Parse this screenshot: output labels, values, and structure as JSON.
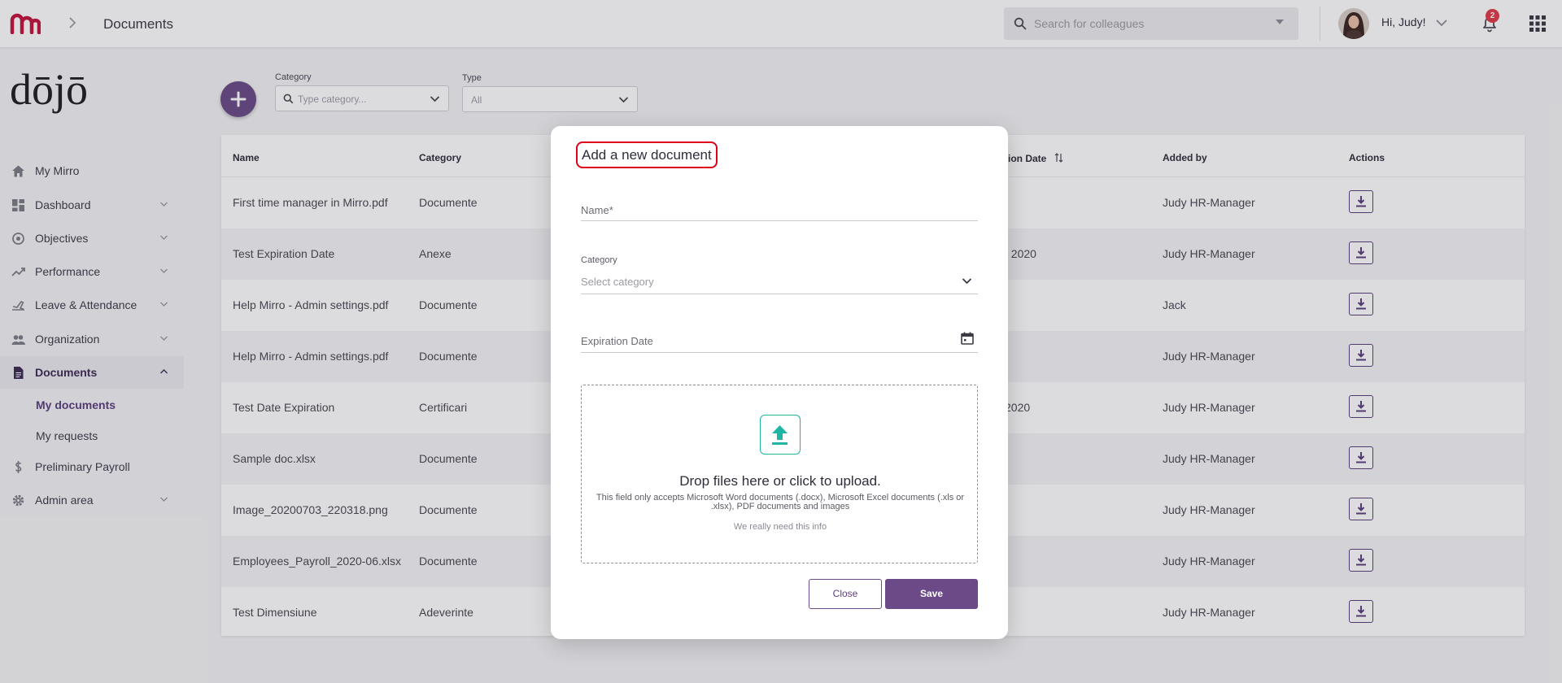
{
  "header": {
    "breadcrumb": "Documents",
    "search_placeholder": "Search for colleagues",
    "greeting": "Hi, Judy!",
    "notification_count": "2"
  },
  "brand": {
    "logo_text": "dōjō"
  },
  "sidebar": {
    "items": [
      {
        "label": "My Mirro",
        "icon": "home-icon"
      },
      {
        "label": "Dashboard",
        "icon": "dashboard-icon"
      },
      {
        "label": "Objectives",
        "icon": "target-icon"
      },
      {
        "label": "Performance",
        "icon": "trend-icon"
      },
      {
        "label": "Leave & Attendance",
        "icon": "plane-icon"
      },
      {
        "label": "Organization",
        "icon": "people-icon"
      },
      {
        "label": "Documents",
        "icon": "document-icon"
      },
      {
        "label": "Preliminary Payroll",
        "icon": "dollar-icon"
      },
      {
        "label": "Admin area",
        "icon": "gear-icon"
      }
    ],
    "sub_items": [
      "My documents",
      "My requests"
    ]
  },
  "filters": {
    "category_label": "Category",
    "category_placeholder": "Type category...",
    "type_label": "Type",
    "type_value": "All"
  },
  "table": {
    "headers": {
      "name": "Name",
      "category": "Category",
      "expiration": "tion Date",
      "added_by": "Added by",
      "actions": "Actions"
    },
    "rows": [
      {
        "name": "First time manager in Mirro.pdf",
        "category": "Documente",
        "exp": "",
        "added_by": "Judy HR-Manager"
      },
      {
        "name": "Test Expiration Date",
        "category": "Anexe",
        "exp": ", 2020",
        "added_by": "Judy HR-Manager"
      },
      {
        "name": "Help Mirro - Admin settings.pdf",
        "category": "Documente",
        "exp": "",
        "added_by": "Jack"
      },
      {
        "name": "Help Mirro - Admin settings.pdf",
        "category": "Documente",
        "exp": "",
        "added_by": "Judy HR-Manager"
      },
      {
        "name": "Test Date Expiration",
        "category": "Certificari",
        "exp": "2020",
        "added_by": "Judy HR-Manager"
      },
      {
        "name": "Sample doc.xlsx",
        "category": "Documente",
        "exp": "",
        "added_by": "Judy HR-Manager"
      },
      {
        "name": "Image_20200703_220318.png",
        "category": "Documente",
        "exp": "",
        "added_by": "Judy HR-Manager"
      },
      {
        "name": "Employees_Payroll_2020-06.xlsx",
        "category": "Documente",
        "exp": "",
        "added_by": "Judy HR-Manager"
      },
      {
        "name": "Test Dimensiune",
        "category": "Adeverinte",
        "exp": "",
        "added_by": "Judy HR-Manager"
      }
    ]
  },
  "modal": {
    "title": "Add a new document",
    "name_label": "Name",
    "name_required": "*",
    "category_label": "Category",
    "category_placeholder": "Select category",
    "expiration_label": "Expiration Date",
    "drop_title": "Drop files here or click to upload.",
    "drop_desc": "This field only accepts Microsoft Word documents (.docx), Microsoft Excel documents (.xls or .xlsx), PDF documents and images",
    "drop_hint": "We really need this info",
    "close_label": "Close",
    "save_label": "Save"
  },
  "colors": {
    "accent": "#6b4a87",
    "brand_red": "#c4123f",
    "upload_teal": "#1fb5a3",
    "highlight": "#e0001b"
  }
}
